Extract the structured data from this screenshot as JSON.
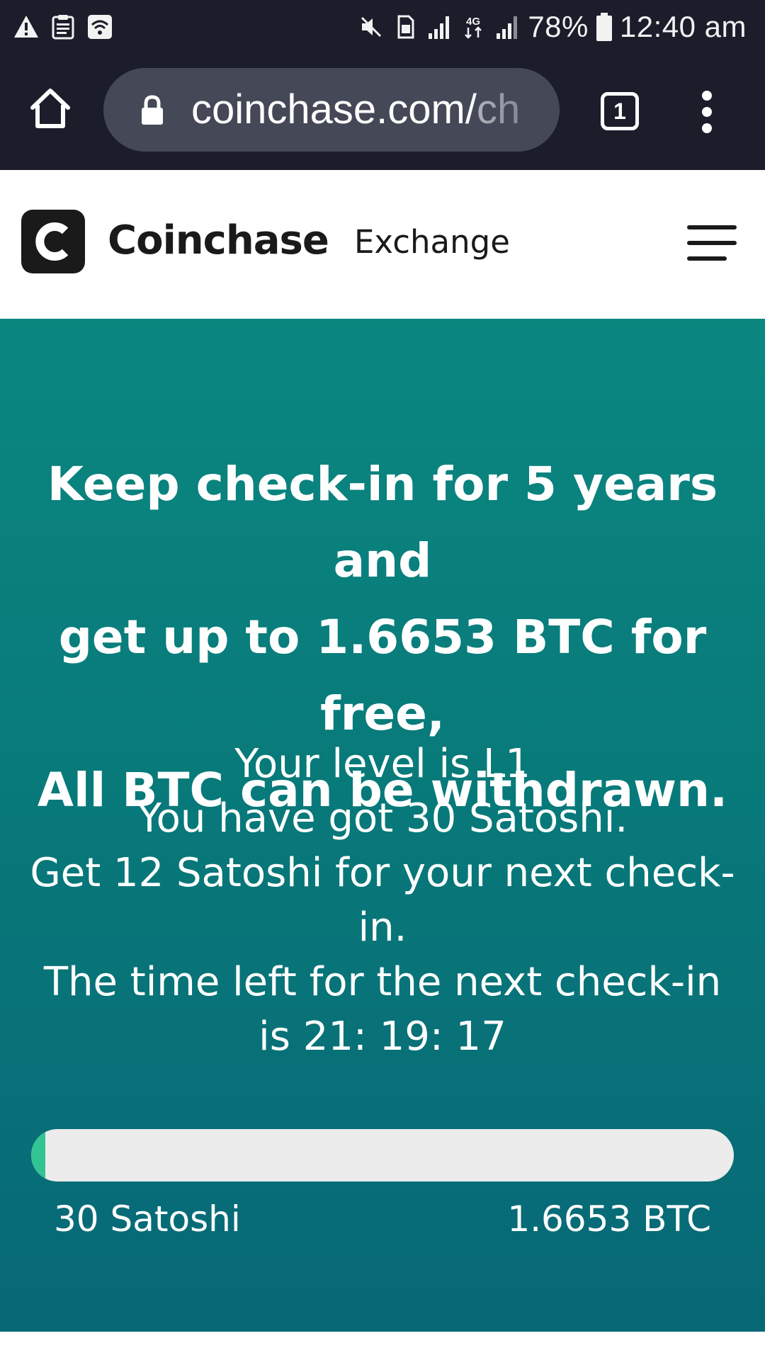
{
  "status_bar": {
    "left_icons": [
      "warning-icon",
      "clipboard-icon",
      "wifi-icon"
    ],
    "right_icons": [
      "mute-icon",
      "sim-card-icon",
      "signal-icon",
      "4g-data-icon",
      "signal-icon"
    ],
    "battery_percent": "78%",
    "time": "12:40 am"
  },
  "browser": {
    "url_main": "coinchase.com/",
    "url_fade": "ch",
    "tab_count": "1",
    "icons": [
      "home-icon",
      "lock-icon",
      "more-vert-icon"
    ]
  },
  "site": {
    "brand": "Coinchase",
    "logo_letter": "C",
    "nav_exchange": "Exchange"
  },
  "hero": {
    "headline_lines": [
      "Keep check-in for 5 years and",
      "get up to 1.6653 BTC for free,",
      "All BTC can be withdrawn."
    ],
    "info_lines": [
      "Your level is L1",
      "You have got 30 Satoshi.",
      "Get 12 Satoshi for your next check-",
      "in.",
      "The time left for the next check-in",
      "is 21: 19: 17"
    ],
    "progress_fraction": 0.02,
    "progress_min_label": "30 Satoshi",
    "progress_max_label": "1.6653 BTC"
  },
  "colors": {
    "system_bar": "#1b1d2b",
    "url_box": "#454856",
    "hero_top": "#0b8780",
    "hero_bottom": "#076876",
    "progress_fill": "#33c493",
    "progress_track": "#ececec"
  }
}
